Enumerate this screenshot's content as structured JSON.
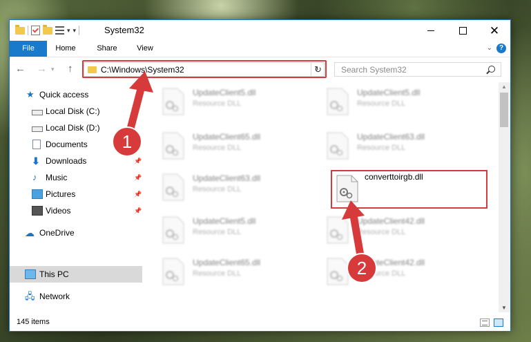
{
  "window": {
    "title": "System32"
  },
  "ribbon": {
    "tabs": [
      "File",
      "Home",
      "Share",
      "View"
    ]
  },
  "navbar": {
    "address": "C:\\Windows\\System32",
    "search_placeholder": "Search System32"
  },
  "sidebar": {
    "items": [
      {
        "label": "Quick access",
        "icon": "star-icon"
      },
      {
        "label": "Local Disk (C:)",
        "icon": "disk-icon"
      },
      {
        "label": "Local Disk (D:)",
        "icon": "disk-icon"
      },
      {
        "label": "Documents",
        "icon": "documents-icon"
      },
      {
        "label": "Downloads",
        "icon": "downloads-icon"
      },
      {
        "label": "Music",
        "icon": "music-icon"
      },
      {
        "label": "Pictures",
        "icon": "pictures-icon"
      },
      {
        "label": "Videos",
        "icon": "videos-icon"
      },
      {
        "label": "OneDrive",
        "icon": "cloud-icon"
      },
      {
        "label": "This PC",
        "icon": "computer-icon"
      },
      {
        "label": "Network",
        "icon": "network-icon"
      }
    ]
  },
  "files": [
    {
      "name": "UpdateClient5.dll",
      "type": "Resource DLL"
    },
    {
      "name": "UpdateClient5.dll",
      "type": "Resource DLL"
    },
    {
      "name": "UpdateClient65.dll",
      "type": "Resource DLL"
    },
    {
      "name": "UpdateClient63.dll",
      "type": "Resource DLL"
    },
    {
      "name": "UpdateClient63.dll",
      "type": "Resource DLL"
    },
    {
      "name": "converttoirgb.dll",
      "type": ""
    },
    {
      "name": "UpdateClient5.dll",
      "type": "Resource DLL"
    },
    {
      "name": "UpdateClient42.dll",
      "type": "Resource DLL"
    },
    {
      "name": "UpdateClient65.dll",
      "type": "Resource DLL"
    },
    {
      "name": "UpdateClient42.dll",
      "type": "Resource DLL"
    }
  ],
  "status": {
    "item_count": "145 items"
  },
  "callouts": [
    "1",
    "2"
  ],
  "colors": {
    "accent": "#1979ca",
    "highlight": "#d63a3a",
    "selected": "#cce8ff"
  }
}
